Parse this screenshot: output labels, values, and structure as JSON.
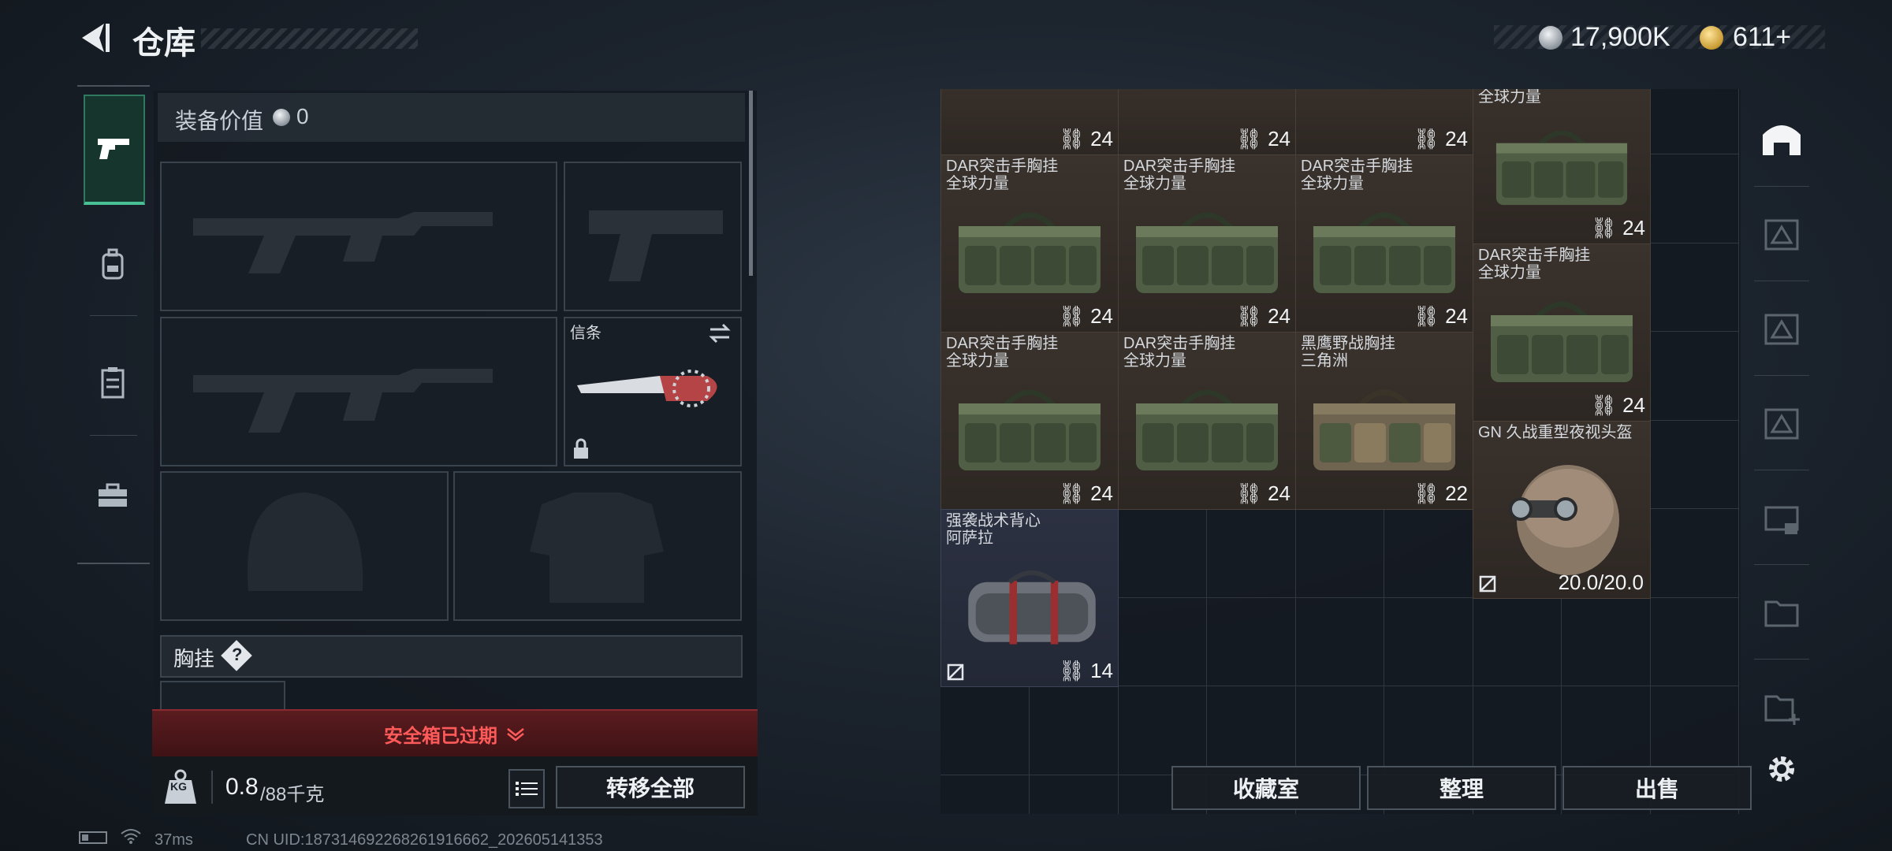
{
  "header": {
    "title": "仓库",
    "currency_silver": "17,900K",
    "currency_gold": "611+"
  },
  "equipment": {
    "value_label": "装备价值",
    "value": "0",
    "melee_label": "信条",
    "vest_label": "胸挂",
    "vest_hint": "?",
    "safebox_expired": "安全箱已过期",
    "weight_current": "0.8",
    "weight_max": "/88千克",
    "weight_icon_text": "KG",
    "transfer_all": "转移全部"
  },
  "storage": {
    "partial_top": [
      {
        "count": "24"
      },
      {
        "count": "24"
      },
      {
        "count": "24"
      },
      {
        "name": "全球力量",
        "count": "24"
      }
    ],
    "items": [
      {
        "name1": "DAR突击手胸挂",
        "name2": "全球力量",
        "count": "24"
      },
      {
        "name1": "DAR突击手胸挂",
        "name2": "全球力量",
        "count": "24"
      },
      {
        "name1": "DAR突击手胸挂",
        "name2": "全球力量",
        "count": "24"
      },
      {
        "name1": "DAR突击手胸挂",
        "name2": "全球力量",
        "count": "24"
      },
      {
        "name1": "DAR突击手胸挂",
        "name2": "全球力量",
        "count": "24"
      },
      {
        "name1": "DAR突击手胸挂",
        "name2": "全球力量",
        "count": "24"
      },
      {
        "name1": "黑鹰野战胸挂",
        "name2": "三角洲",
        "count": "22"
      },
      {
        "name1": "强袭战术背心",
        "name2": "阿萨拉",
        "count": "14"
      }
    ],
    "helmet": {
      "name": "GN 久战重型夜视头盔",
      "durability": "20.0/20.0"
    },
    "buttons": {
      "collection": "收藏室",
      "sort": "整理",
      "sell": "出售"
    }
  },
  "status_bar": {
    "ping": "37ms",
    "uid": "CN UID:18731469226826191666​2_202605141353"
  },
  "colors": {
    "accent_green": "#49c196",
    "expired_red": "#ff5a5a"
  },
  "icons": [
    "back-arrow-icon",
    "silver-coin-icon",
    "gold-coin-icon",
    "pistol-icon",
    "backpack-icon",
    "vest-icon",
    "toolbox-icon",
    "swap-icon",
    "lock-icon",
    "weight-icon",
    "list-icon",
    "no-trade-icon",
    "gear-icon"
  ]
}
